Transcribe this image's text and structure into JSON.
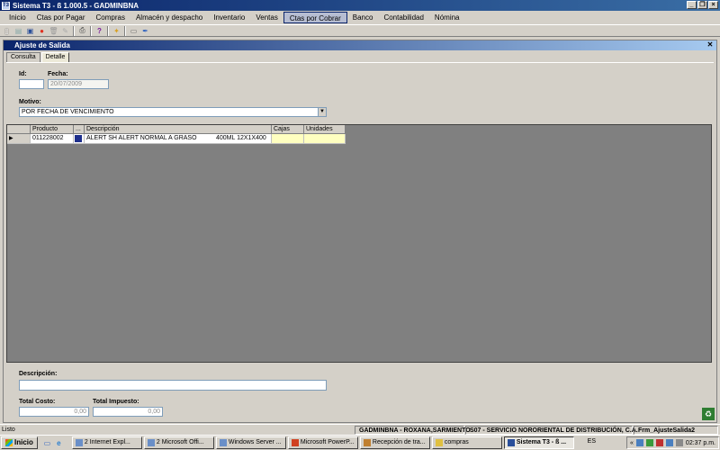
{
  "window": {
    "title": "Sistema T3 - ß 1.000.5 - GADMINBNA",
    "app_icon": "T3"
  },
  "menu": [
    "Inicio",
    "Ctas por Pagar",
    "Compras",
    "Almacén y despacho",
    "Inventario",
    "Ventas",
    "Ctas por Cobrar",
    "Banco",
    "Contabilidad",
    "Nómina"
  ],
  "menu_active": "Ctas por Cobrar",
  "child": {
    "title": "Ajuste de Salida"
  },
  "tabs": [
    "Consulta",
    "Detalle"
  ],
  "form": {
    "id_label": "Id:",
    "id_value": "",
    "fecha_label": "Fecha:",
    "fecha_value": "20/07/2009",
    "motivo_label": "Motivo:",
    "motivo_value": "POR FECHA DE VENCIMIENTO",
    "descripcion_label": "Descripción:",
    "descripcion_value": "",
    "total_costo_label": "Total Costo:",
    "total_costo_value": "0,00",
    "total_impuesto_label": "Total Impuesto:",
    "total_impuesto_value": "0,00"
  },
  "grid": {
    "columns": [
      "Producto",
      "...",
      "Descripción",
      "Cajas",
      "Unidades"
    ],
    "rows": [
      {
        "producto": "011228002",
        "descripcion": "ALERT SH ALERT NORMAL A GRASO",
        "presentacion": "400ML 12X1X400",
        "cajas": "",
        "unidades": "",
        "color": "#1e2f8c"
      }
    ]
  },
  "status": {
    "left": "Listo",
    "user": "GADMINBNA - ROXANA,SARMIENTO",
    "company": "S07 - SERVICIO NORORIENTAL DE DISTRIBUCIÓN, C.A.",
    "form": "Frm_AjusteSalida2"
  },
  "taskbar": {
    "start": "Inicio",
    "tasks": [
      "2 Internet Expl...",
      "2 Microsoft Offi...",
      "Windows Server ...",
      "Microsoft PowerP...",
      "Recepción de tra...",
      "compras",
      "Sistema T3 - ß ..."
    ],
    "active_task": "Sistema T3 - ß ...",
    "lang": "ES",
    "time": "02:37 p.m."
  }
}
